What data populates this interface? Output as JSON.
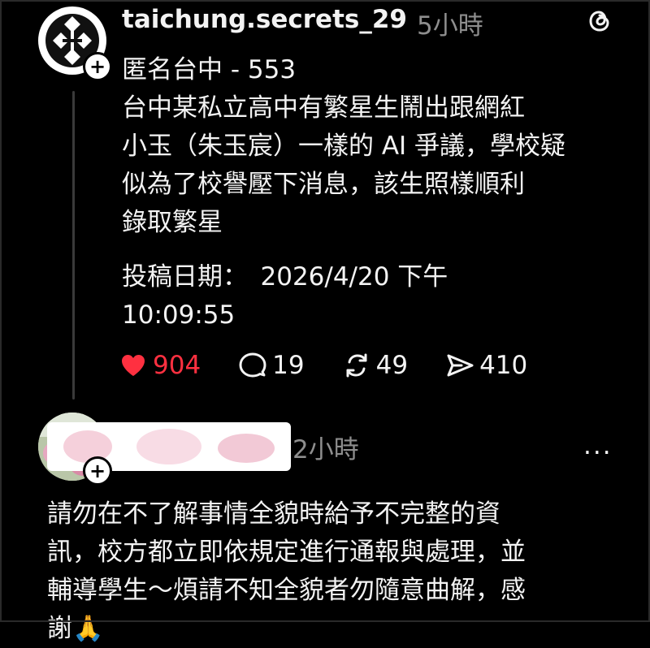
{
  "post": {
    "username": "taichung.secrets_29",
    "time": "5小時",
    "subtitle": "匿名台中 - 553",
    "body_lines": [
      "台中某私立高中有繁星生鬧出跟網紅",
      "小玉（朱玉宸）一樣的 AI 爭議，學校疑",
      "似為了校譽壓下消息，該生照樣順利",
      "錄取繁星"
    ],
    "date_lines": [
      "投稿日期：　2026/4/20 下午",
      "10:09:55"
    ],
    "likes": "904",
    "comments": "19",
    "reposts": "49",
    "shares": "410"
  },
  "reply": {
    "time": "2小時",
    "more": "···",
    "text_lines": [
      "請勿在不了解事情全貌時給予不完整的資",
      "訊，校方都立即依規定進行通報與處理，並",
      "輔導學生～煩請不知全貌者勿隨意曲解，感",
      "謝🙏"
    ]
  },
  "icons": {
    "avatar": "logo-avatar",
    "threads": "threads-logo-icon",
    "like": "heart-icon",
    "comment": "comment-icon",
    "repost": "repost-icon",
    "share": "share-icon",
    "follow": "plus-icon"
  },
  "colors": {
    "background": "#000000",
    "like": "#ff3040",
    "muted": "#8e8e8e"
  }
}
